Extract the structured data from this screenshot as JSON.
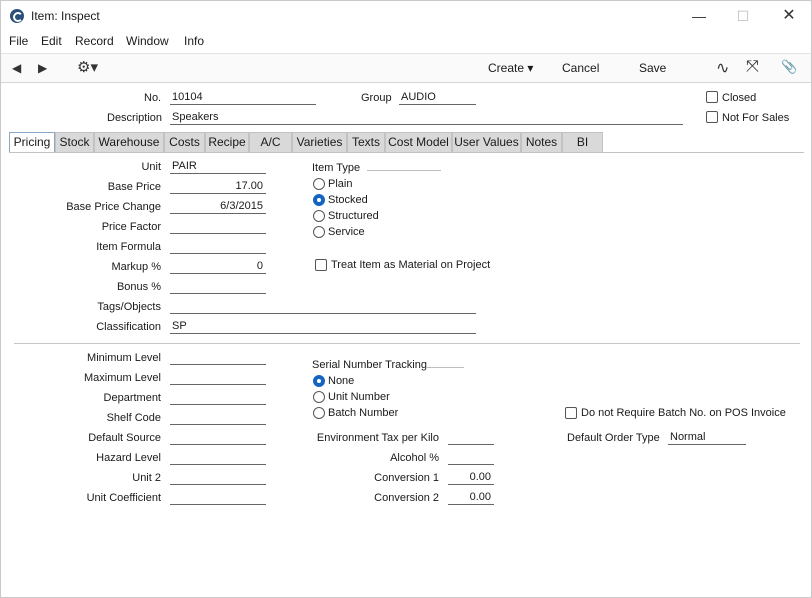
{
  "window": {
    "title": "Item: Inspect",
    "minimize": "—",
    "maximize": "☐",
    "close": "✕"
  },
  "menu": [
    "File",
    "Edit",
    "Record",
    "Window",
    "Info"
  ],
  "toolbar": {
    "back": "◀",
    "forward": "▶",
    "gear": "⚙▾",
    "create": "Create ▾",
    "cancel": "Cancel",
    "save": "Save",
    "activity": "∿",
    "expand": "⤧",
    "attach": "📎"
  },
  "header": {
    "no_label": "No.",
    "no_value": "10104",
    "group_label": "Group",
    "group_value": "AUDIO",
    "description_label": "Description",
    "description_value": "Speakers",
    "closed_label": "Closed",
    "not_for_sales_label": "Not For Sales"
  },
  "tabs": [
    "Pricing",
    "Stock",
    "Warehouse",
    "Costs",
    "Recipe",
    "A/C",
    "Varieties",
    "Texts",
    "Cost Model",
    "User Values",
    "Notes",
    "BI"
  ],
  "pricing": {
    "unit_label": "Unit",
    "unit_value": "PAIR",
    "base_price_label": "Base Price",
    "base_price_value": "17.00",
    "base_price_change_label": "Base Price Change",
    "base_price_change_value": "6/3/2015",
    "price_factor_label": "Price Factor",
    "price_factor_value": "",
    "item_formula_label": "Item Formula",
    "item_formula_value": "",
    "markup_label": "Markup %",
    "markup_value": "0",
    "bonus_label": "Bonus %",
    "bonus_value": "",
    "tags_label": "Tags/Objects",
    "tags_value": "",
    "classification_label": "Classification",
    "classification_value": "SP",
    "item_type_label": "Item Type",
    "item_types": [
      "Plain",
      "Stocked",
      "Structured",
      "Service"
    ],
    "item_type_selected": "Stocked",
    "treat_material_label": "Treat Item as Material on Project"
  },
  "stock": {
    "minimum_level_label": "Minimum Level",
    "maximum_level_label": "Maximum Level",
    "department_label": "Department",
    "shelf_code_label": "Shelf Code",
    "default_source_label": "Default Source",
    "hazard_level_label": "Hazard Level",
    "unit2_label": "Unit 2",
    "unit_coefficient_label": "Unit Coefficient",
    "serial_tracking_label": "Serial Number Tracking",
    "serial_options": [
      "None",
      "Unit Number",
      "Batch Number"
    ],
    "serial_selected": "None",
    "env_tax_label": "Environment Tax per Kilo",
    "alcohol_label": "Alcohol %",
    "conversion1_label": "Conversion 1",
    "conversion1_value": "0.00",
    "conversion2_label": "Conversion 2",
    "conversion2_value": "0.00",
    "no_batch_pos_label": "Do not Require Batch No. on POS Invoice",
    "default_order_type_label": "Default Order Type",
    "default_order_type_value": "Normal"
  }
}
